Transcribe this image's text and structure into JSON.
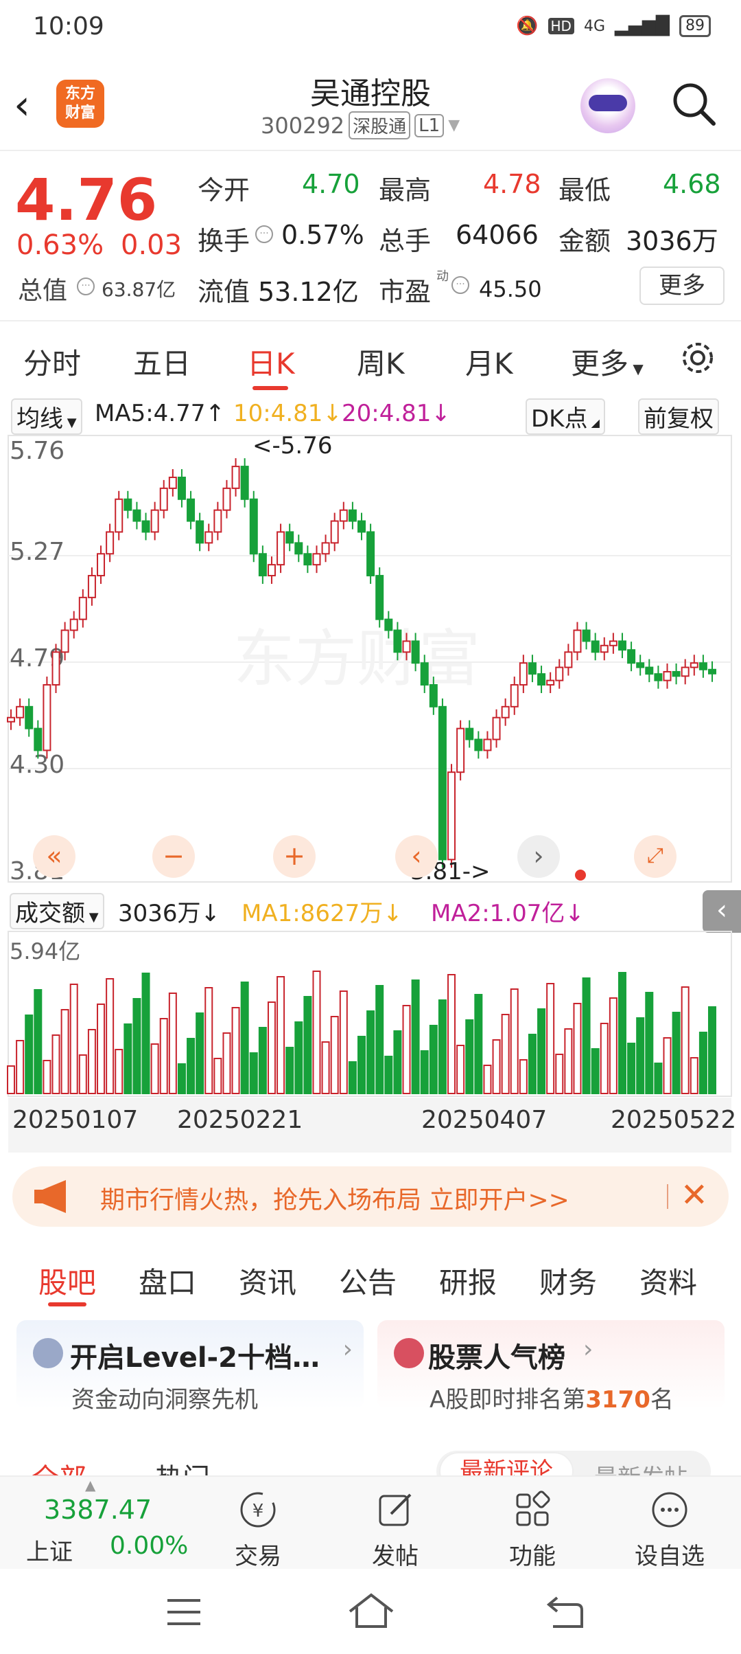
{
  "status": {
    "time": "10:09",
    "network": "4G",
    "battery": "89"
  },
  "header": {
    "title": "吴通控股",
    "code": "300292",
    "tag1": "深股通",
    "tag2": "L1",
    "logo": "东方\n财富"
  },
  "quote": {
    "price": "4.76",
    "change_pct": "0.63%",
    "change": "0.03",
    "market_cap_label": "总值",
    "market_cap": "63.87亿",
    "open_label": "今开",
    "open": "4.70",
    "high_label": "最高",
    "high": "4.78",
    "low_label": "最低",
    "low": "4.68",
    "turnover_label": "换手",
    "turnover": "0.57%",
    "volume_label": "总手",
    "volume": "64066",
    "amount_label": "金额",
    "amount": "3036万",
    "float_cap_label": "流值",
    "float_cap": "53.12亿",
    "pe_label": "市盈",
    "pe_sup": "动",
    "pe": "45.50",
    "more": "更多"
  },
  "tabs": [
    "分时",
    "五日",
    "日K",
    "周K",
    "月K",
    "更多"
  ],
  "chart_toolbar": {
    "ma_select": "均线",
    "ma5": "MA5:4.77↑",
    "ma10": "10:4.81↓",
    "ma20": "20:4.81↓",
    "dk": "DK点",
    "adjust": "前复权"
  },
  "chart_data": {
    "type": "candlestick",
    "price_axis_labels": [
      "5.76",
      "5.27",
      "4.79",
      "4.30",
      "3.81"
    ],
    "annotations": [
      "<-5.76",
      "3.81->"
    ],
    "colors": {
      "up": "#c8232c",
      "down": "#17a13a",
      "ma5": "#111111",
      "ma10": "#f0b020",
      "ma20": "#c0209a"
    },
    "volume_toolbar": {
      "label": "成交额",
      "value": "3036万↓",
      "ma1": "MA1:8627万↓",
      "ma2": "MA2:1.07亿↓"
    },
    "volume_axis_label": "5.94亿",
    "date_labels": [
      "20250107",
      "20250221",
      "20250407",
      "20250522"
    ]
  },
  "banner": {
    "text": "期市行情火热，抢先入场布局 立即开户>>"
  },
  "subtabs": [
    "股吧",
    "盘口",
    "资讯",
    "公告",
    "研报",
    "财务",
    "资料"
  ],
  "cards": [
    {
      "title": "开启Level-2十档…",
      "subtitle": "资金动向洞察先机"
    },
    {
      "title": "股票人气榜",
      "subtitle_pre": "A股即时排名第",
      "rank": "3170",
      "subtitle_post": "名"
    }
  ],
  "partial_tabs": [
    "全部",
    "热门",
    "最新评论",
    "最新发帖"
  ],
  "bottom_nav": {
    "index_value": "3387.47",
    "index_name": "上证",
    "index_change": "0.00%",
    "items": [
      "交易",
      "发帖",
      "功能",
      "设自选"
    ]
  }
}
